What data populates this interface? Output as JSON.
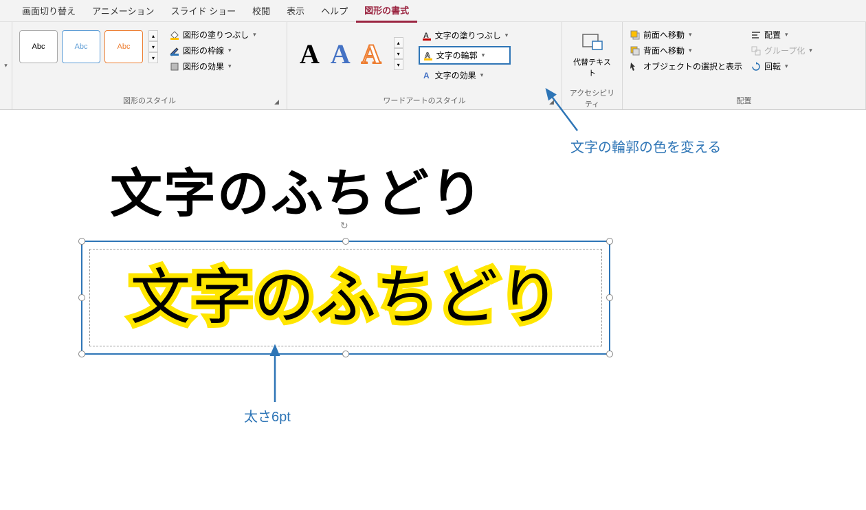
{
  "tabs": {
    "items": [
      "画面切り替え",
      "アニメーション",
      "スライド ショー",
      "校閲",
      "表示",
      "ヘルプ",
      "図形の書式"
    ],
    "activeIndex": 6
  },
  "ribbon": {
    "shapeStyles": {
      "label": "図形のスタイル",
      "sample": "Abc",
      "fill": "図形の塗りつぶし",
      "outline": "図形の枠線",
      "effects": "図形の効果"
    },
    "wordArt": {
      "label": "ワードアートのスタイル",
      "sample": "A",
      "textFill": "文字の塗りつぶし",
      "textOutline": "文字の輪郭",
      "textEffects": "文字の効果"
    },
    "accessibility": {
      "label": "アクセシビリティ",
      "altText": "代替テキスト"
    },
    "arrange": {
      "label": "配置",
      "bringForward": "前面へ移動",
      "sendBackward": "背面へ移動",
      "selectionPane": "オブジェクトの選択と表示",
      "align": "配置",
      "group": "グループ化",
      "rotate": "回転"
    }
  },
  "canvas": {
    "titleText": "文字のふちどり",
    "outlinedText": "文字のふちどり"
  },
  "callouts": {
    "outlineColor": "文字の輪郭の色を変える",
    "thickness": "太さ6pt"
  }
}
